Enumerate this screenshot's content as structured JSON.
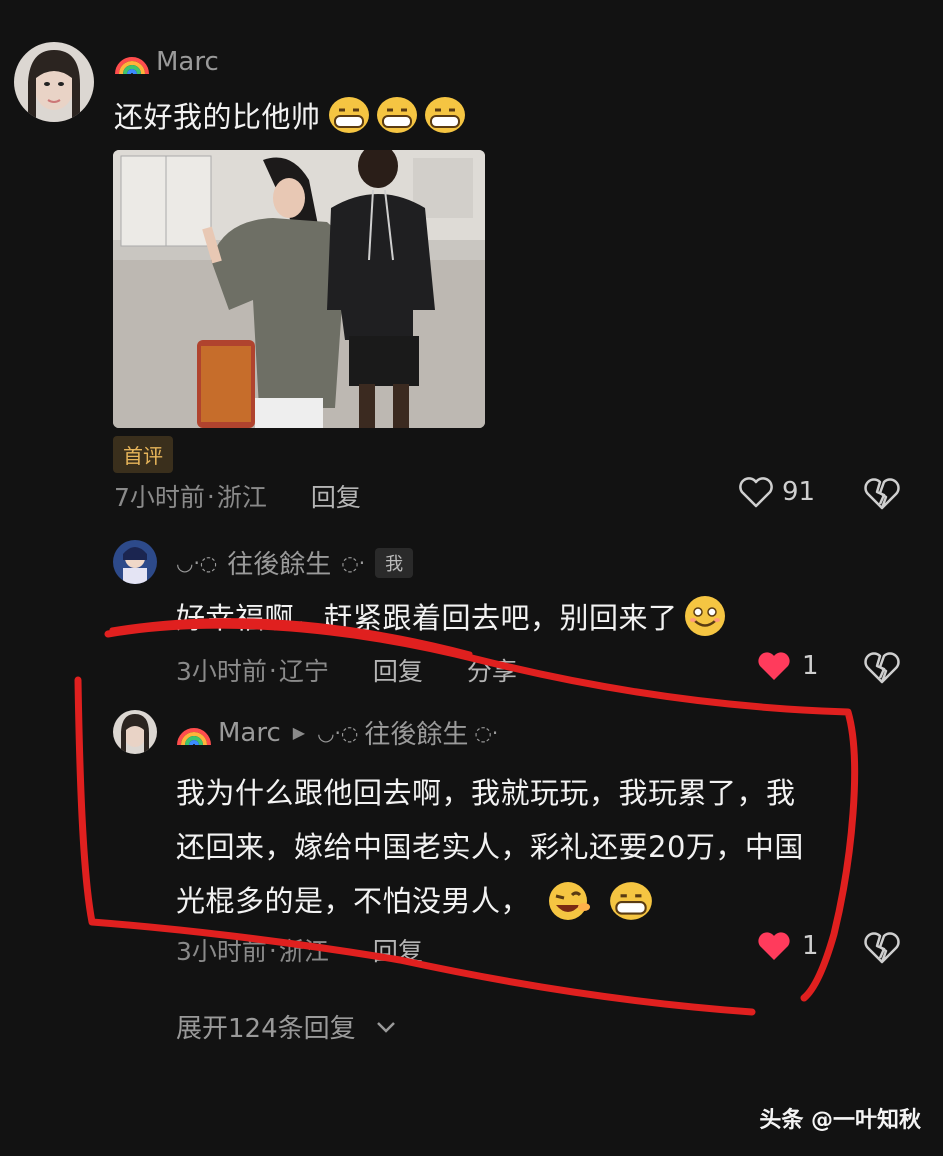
{
  "comment": {
    "username": "Marc",
    "text": "还好我的比他帅",
    "badge": "首评",
    "time": "7小时前",
    "location": "浙江",
    "reply_label": "回复",
    "likes": "91"
  },
  "reply1": {
    "username": "往後餘生",
    "me_badge": "我",
    "text": "好幸福啊，赶紧跟着回去吧，别回来了",
    "time": "3小时前",
    "location": "辽宁",
    "reply_label": "回复",
    "share_label": "分享",
    "likes": "1"
  },
  "reply2": {
    "username": "Marc",
    "reply_to": "往後餘生",
    "text_line1": "我为什么跟他回去啊，我就玩玩，我玩累了，我",
    "text_line2": "还回来，嫁给中国老实人，彩礼还要20万，中国",
    "text_line3": "光棍多的是，不怕没男人，",
    "time": "3小时前",
    "location": "浙江",
    "reply_label": "回复",
    "likes": "1"
  },
  "expand_label": "展开124条回复",
  "watermark": "头条 @一叶知秋",
  "colors": {
    "liked_heart": "#ff3b5c",
    "badge_bg": "#3a2f1c",
    "badge_text": "#e6b45a",
    "annotation_red": "#e0201f"
  },
  "icons": [
    "rainbow-icon",
    "heart-outline-icon",
    "heart-filled-icon",
    "broken-heart-icon",
    "chevron-down-icon",
    "grin-emoji",
    "smile-emoji",
    "wink-emoji"
  ]
}
